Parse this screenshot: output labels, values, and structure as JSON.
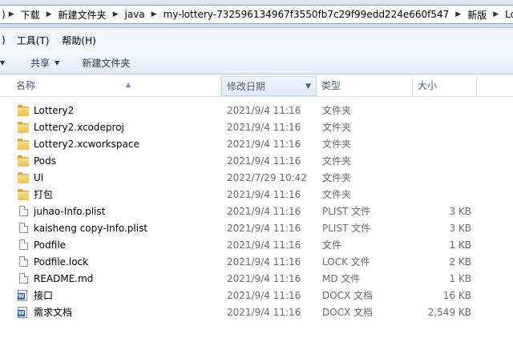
{
  "address": {
    "edge": ")",
    "crumbs": [
      "下载",
      "新建文件夹",
      "java",
      "my-lottery-732596134967f3550fb7c29f99edd224e660f547",
      "新版",
      "Lott"
    ]
  },
  "menu": {
    "edge": ")",
    "items": [
      "工具(T)",
      "帮助(H)"
    ]
  },
  "toolbar": {
    "share_label": "共享",
    "new_folder_label": "新建文件夹"
  },
  "columns": {
    "name": "名称",
    "date": "修改日期",
    "type": "类型",
    "size": "大小"
  },
  "files": [
    {
      "name": "Lottery2",
      "date": "2021/9/4 11:16",
      "type": "文件夹",
      "size": "",
      "icon": "folder-icon"
    },
    {
      "name": "Lottery2.xcodeproj",
      "date": "2021/9/4 11:16",
      "type": "文件夹",
      "size": "",
      "icon": "folder-icon"
    },
    {
      "name": "Lottery2.xcworkspace",
      "date": "2021/9/4 11:16",
      "type": "文件夹",
      "size": "",
      "icon": "folder-icon"
    },
    {
      "name": "Pods",
      "date": "2021/9/4 11:16",
      "type": "文件夹",
      "size": "",
      "icon": "folder-icon"
    },
    {
      "name": "UI",
      "date": "2022/7/29 10:42",
      "type": "文件夹",
      "size": "",
      "icon": "folder-icon"
    },
    {
      "name": "打包",
      "date": "2021/9/4 11:16",
      "type": "文件夹",
      "size": "",
      "icon": "folder-icon"
    },
    {
      "name": "juhao-Info.plist",
      "date": "2021/9/4 11:16",
      "type": "PLIST 文件",
      "size": "3 KB",
      "icon": "file-icon"
    },
    {
      "name": "kaisheng copy-Info.plist",
      "date": "2021/9/4 11:16",
      "type": "PLIST 文件",
      "size": "3 KB",
      "icon": "file-icon"
    },
    {
      "name": "Podfile",
      "date": "2021/9/4 11:16",
      "type": "文件",
      "size": "1 KB",
      "icon": "file-icon"
    },
    {
      "name": "Podfile.lock",
      "date": "2021/9/4 11:16",
      "type": "LOCK 文件",
      "size": "2 KB",
      "icon": "file-icon"
    },
    {
      "name": "README.md",
      "date": "2021/9/4 11:16",
      "type": "MD 文件",
      "size": "1 KB",
      "icon": "file-icon"
    },
    {
      "name": "接口",
      "date": "2021/9/4 11:16",
      "type": "DOCX 文档",
      "size": "16 KB",
      "icon": "docx-icon"
    },
    {
      "name": "需求文档",
      "date": "2021/9/4 11:16",
      "type": "DOCX 文档",
      "size": "2,549 KB",
      "icon": "docx-icon"
    }
  ]
}
